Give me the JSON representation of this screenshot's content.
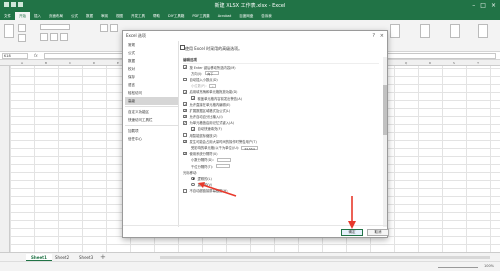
{
  "window": {
    "title": "新建 XLSX 工作表.xlsx - Excel",
    "controls": [
      "–",
      "□",
      "×"
    ]
  },
  "menu": {
    "items": [
      "文件",
      "开始",
      "插入",
      "页面布局",
      "公式",
      "数据",
      "审阅",
      "视图",
      "开发工具",
      "帮助",
      "DIY工具箱",
      "PDF工具集",
      "Acrobat",
      "百度网盘",
      "告诉我"
    ],
    "active_index": 1
  },
  "formula_bar": {
    "name_box": "K18",
    "fx_label": "fx"
  },
  "grid": {
    "columns": [
      "A",
      "B",
      "C",
      "D",
      "E",
      "F",
      "G",
      "H",
      "I",
      "J",
      "K",
      "L",
      "M",
      "N",
      "O",
      "P",
      "Q",
      "R",
      "S",
      "T"
    ]
  },
  "sheets": {
    "tabs": [
      "Sheet1",
      "Sheet2",
      "Sheet3"
    ],
    "active_index": 0,
    "add_label": "+"
  },
  "status": {
    "zoom": "100%"
  },
  "dialog": {
    "title": "Excel 选项",
    "help": "?",
    "close": "×",
    "nav": [
      "常规",
      "公式",
      "数据",
      "校对",
      "保存",
      "语言",
      "轻松访问",
      "高级",
      "自定义功能区",
      "快速访问工具栏",
      "加载项",
      "信任中心"
    ],
    "nav_active_index": 7,
    "header": "使用 Excel 时采用的高级选项。",
    "sections": {
      "editing": "编辑选项",
      "cut_copy": "剪切、复制和粘贴",
      "pen": "笔"
    },
    "options": {
      "after_enter": "按 Enter 键后移动所选内容(M)",
      "direction_label": "方向(I):",
      "direction_value": "向下",
      "auto_decimal": "自动插入小数点(D)",
      "decimal_places_label": "小位数(P):",
      "decimal_places_value": "2",
      "fill_handle": "启用填充柄和单元格拖放功能(D)",
      "overwrite_alert": "覆盖单元格内容前发出警告(A)",
      "direct_edit": "允许直接在单元格内编辑(E)",
      "extend_formats": "扩展数据区域格式及公式(L)",
      "auto_percent": "允许自动百分比输入(I)",
      "autocomplete": "为单元格值启用记忆式键入(A)",
      "flash_fill": "自动快速填充(F)",
      "ctrl_scroll": "用智能鼠标缩放(Z)",
      "slow_alert": "发生可能会占用大量时间的操作时警告用户(T)",
      "when_cells": "受影响的单元格(以千为单位)(U):",
      "when_cells_value": "33,554",
      "system_sep": "使用系统分隔符(U)",
      "decimal_sep": "小数分隔符(D):",
      "thousands_sep": "千位分隔符(T):",
      "cursor_movement": "光标移动:",
      "logical": "逻辑的(L)",
      "visual": "直观的(V)",
      "no_hyperlink": "不自动超链接屏幕截图(H)"
    },
    "buttons": {
      "ok": "确定",
      "cancel": "取消"
    }
  },
  "annotation_color": "#e8392c"
}
